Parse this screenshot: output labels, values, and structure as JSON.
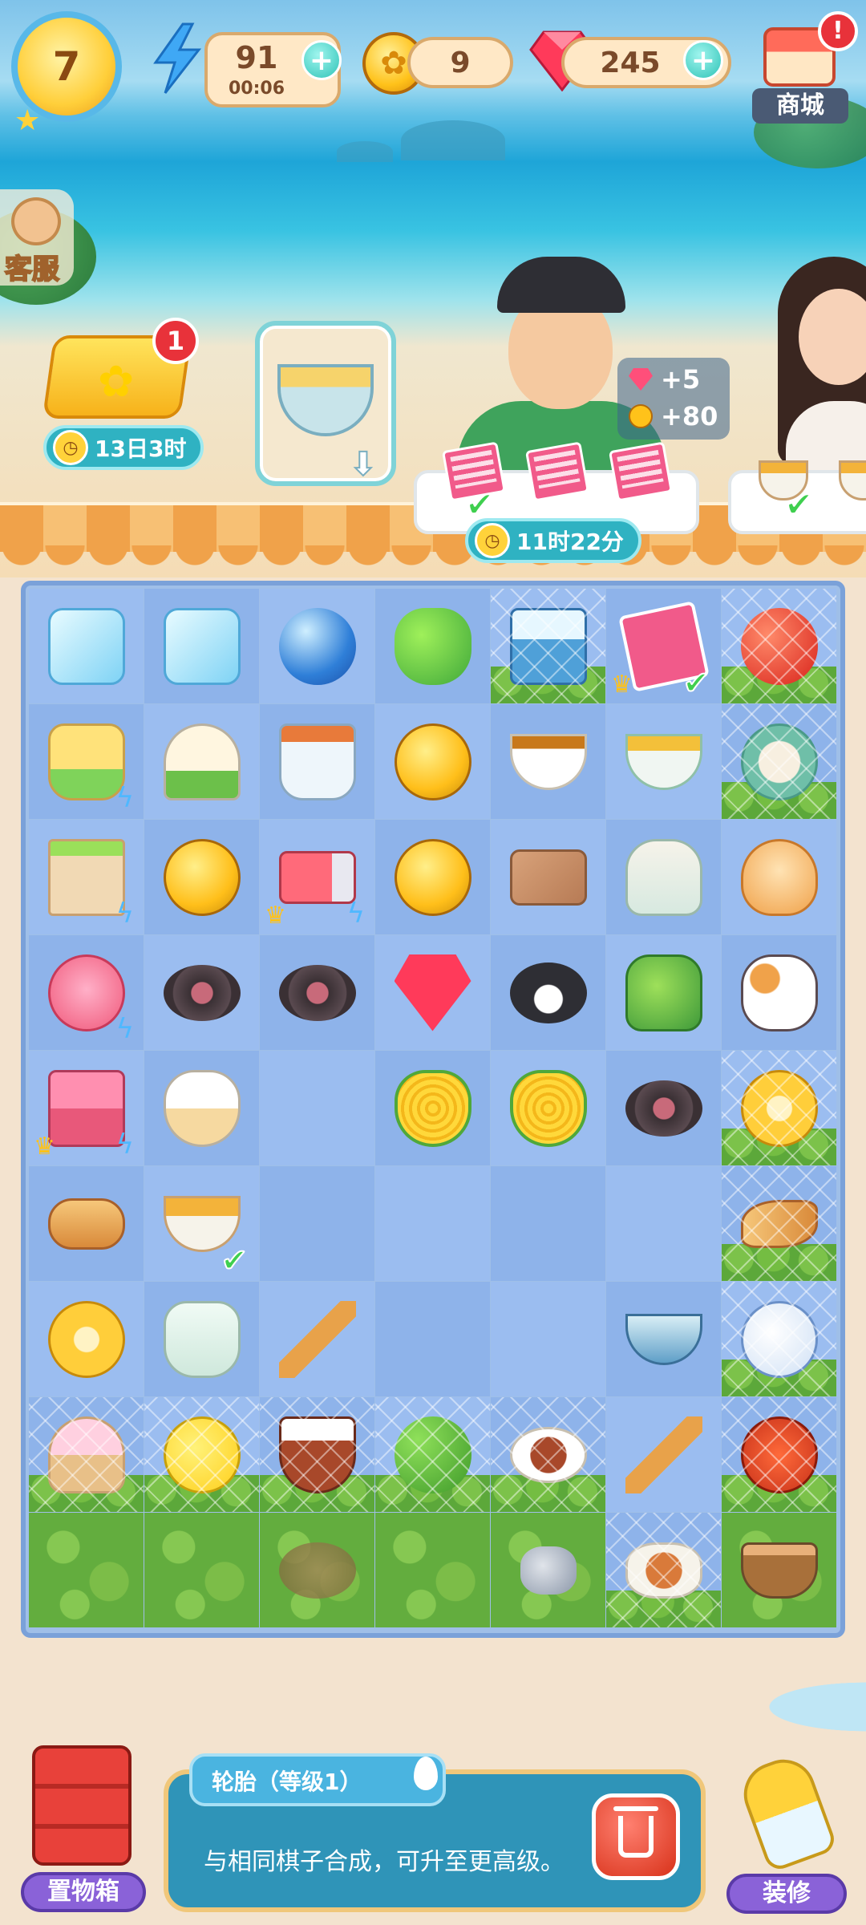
{
  "hud": {
    "level": "7",
    "energy": "91",
    "energy_timer": "00:06",
    "coins": "9",
    "gems": "245",
    "plus_symbol": "+"
  },
  "shop": {
    "label": "商城",
    "alert": "!"
  },
  "customer_service": {
    "label": "客服"
  },
  "event": {
    "badge": "1",
    "timer": "13日3时"
  },
  "order_timer": "11时22分",
  "rewards": {
    "gems": "+5",
    "coins": "+80"
  },
  "board": {
    "rows": [
      [
        {
          "item": "ice-bowl",
          "glyph": "g-ice"
        },
        {
          "item": "ice-cubes",
          "glyph": "g-ice"
        },
        {
          "item": "blue-orb",
          "glyph": "g-orb"
        },
        {
          "item": "green-pepper",
          "glyph": "g-pepper"
        },
        {
          "item": "ice-cooler",
          "glyph": "g-cooler",
          "web": true,
          "hedge": true
        },
        {
          "item": "road-sign",
          "glyph": "g-sign",
          "crown": true,
          "tick": true
        },
        {
          "item": "cherries",
          "glyph": "g-cherry",
          "web": true,
          "hedge": true
        }
      ],
      [
        {
          "item": "juicer",
          "glyph": "g-juicer",
          "bolt": true
        },
        {
          "item": "lemon-squeezer",
          "glyph": "g-dome"
        },
        {
          "item": "lemon-tea-mug",
          "glyph": "g-mug"
        },
        {
          "item": "gold-coins",
          "glyph": "g-coins"
        },
        {
          "item": "tea-cup",
          "glyph": "g-tea"
        },
        {
          "item": "egg-soup-bowl",
          "glyph": "g-bowl"
        },
        {
          "item": "dumpling-bowl",
          "glyph": "g-dumpling",
          "web": true,
          "hedge": true
        }
      ],
      [
        {
          "item": "grocery-bag",
          "glyph": "g-bag",
          "bolt": true
        },
        {
          "item": "coin-pile",
          "glyph": "g-coins"
        },
        {
          "item": "delivery-truck",
          "glyph": "g-truck",
          "crown": true,
          "bolt": true
        },
        {
          "item": "gold-coins",
          "glyph": "g-coins"
        },
        {
          "item": "parcel",
          "glyph": "g-parcel"
        },
        {
          "item": "sake-set",
          "glyph": "g-vase"
        },
        {
          "item": "orange-cat",
          "glyph": "g-cat-orange"
        }
      ],
      [
        {
          "item": "pet-bed",
          "glyph": "g-cake",
          "bolt": true
        },
        {
          "item": "tire-stack",
          "glyph": "g-tire"
        },
        {
          "item": "tire",
          "glyph": "g-tire"
        },
        {
          "item": "ruby-gem",
          "glyph": "g-gem"
        },
        {
          "item": "black-cat",
          "glyph": "g-cat-black"
        },
        {
          "item": "green-jug",
          "glyph": "g-jug"
        },
        {
          "item": "calico-cat",
          "glyph": "g-cat-calico"
        }
      ],
      [
        {
          "item": "food-machine",
          "glyph": "g-machine",
          "crown": true,
          "bolt": true
        },
        {
          "item": "soup-pot",
          "glyph": "g-pot"
        },
        {
          "item": "",
          "glyph": ""
        },
        {
          "item": "corn-cob",
          "glyph": "g-corn"
        },
        {
          "item": "corn-kernel",
          "glyph": "g-corn"
        },
        {
          "item": "cat-tire-toy",
          "glyph": "g-tire"
        },
        {
          "item": "golden-vase",
          "glyph": "g-vacuum",
          "web": true,
          "hedge": true
        }
      ],
      [
        {
          "item": "fried-snack",
          "glyph": "g-snack"
        },
        {
          "item": "egg-soup-cup",
          "glyph": "g-soupcup",
          "tick": true
        },
        {
          "item": "",
          "glyph": ""
        },
        {
          "item": "",
          "glyph": ""
        },
        {
          "item": "",
          "glyph": ""
        },
        {
          "item": "",
          "glyph": ""
        },
        {
          "item": "grilled-fish",
          "glyph": "g-fish",
          "web": true,
          "hedge": true
        }
      ],
      [
        {
          "item": "golden-fan",
          "glyph": "g-vacuum"
        },
        {
          "item": "white-cup",
          "glyph": "g-cup-white"
        },
        {
          "item": "wooden-spatula",
          "glyph": "g-spatula"
        },
        {
          "item": "",
          "glyph": ""
        },
        {
          "item": "",
          "glyph": ""
        },
        {
          "item": "blue-bowl",
          "glyph": "g-bluebowl"
        },
        {
          "item": "teapot",
          "glyph": "g-teapot",
          "web": true,
          "hedge": true
        }
      ],
      [
        {
          "item": "ice-cream-bowl",
          "glyph": "g-icecream",
          "web": true,
          "hedge": true
        },
        {
          "item": "lemon-bowl",
          "glyph": "g-lemon",
          "web": true,
          "hedge": true
        },
        {
          "item": "hot-pot",
          "glyph": "g-hotpot",
          "web": true,
          "hedge": true
        },
        {
          "item": "broccoli",
          "glyph": "g-broccoli",
          "web": true,
          "hedge": true
        },
        {
          "item": "meat-plate",
          "glyph": "g-plate",
          "web": true,
          "hedge": true
        },
        {
          "item": "metal-spatula",
          "glyph": "g-spatula"
        },
        {
          "item": "crab-dish",
          "glyph": "g-crab",
          "web": true,
          "hedge": true
        }
      ],
      [
        {
          "item": "grass",
          "glyph": "",
          "grass": true
        },
        {
          "item": "grass",
          "glyph": "",
          "grass": true
        },
        {
          "item": "dirt-patch",
          "glyph": "g-dirt",
          "grass": true
        },
        {
          "item": "grass",
          "glyph": "",
          "grass": true
        },
        {
          "item": "rock",
          "glyph": "g-rock",
          "grass": true
        },
        {
          "item": "fish-plate",
          "glyph": "g-fishplate",
          "web": true,
          "hedge": true
        },
        {
          "item": "tree-stump",
          "glyph": "g-stump",
          "grass": true
        }
      ]
    ]
  },
  "info": {
    "title": "轮胎（等级1）",
    "description": "与相同棋子合成，可升至更高级。"
  },
  "bottom": {
    "storage_label": "置物箱",
    "decor_label": "装修"
  }
}
